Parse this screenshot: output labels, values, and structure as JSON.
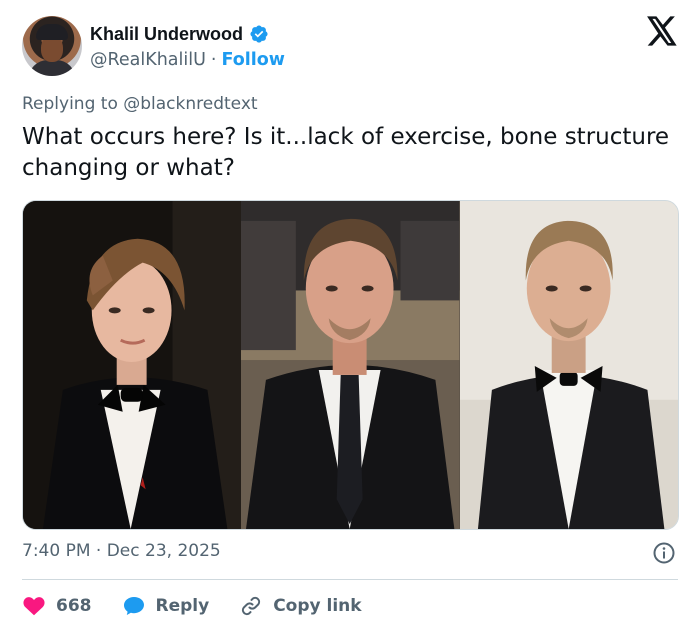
{
  "author": {
    "name": "Khalil Underwood",
    "handle": "@RealKhalilU",
    "separator": "·",
    "follow_label": "Follow",
    "verified_color": "#1d9bf0"
  },
  "reply_context": {
    "prefix": "Replying to",
    "target": "@blacknredtext"
  },
  "tweet": {
    "text": "What occurs here? Is it...lack of exercise, bone structure changing or what?"
  },
  "media": {
    "count": 3
  },
  "meta": {
    "time": "7:40 PM",
    "separator": "·",
    "date": "Dec 23, 2025"
  },
  "actions": {
    "like_count": "668",
    "reply_label": "Reply",
    "copy_label": "Copy link",
    "like_color": "#f91880",
    "reply_color": "#1d9bf0"
  },
  "icons": [
    "x-logo-icon",
    "verified-badge-icon",
    "info-icon",
    "heart-icon",
    "reply-bubble-icon",
    "link-icon"
  ]
}
